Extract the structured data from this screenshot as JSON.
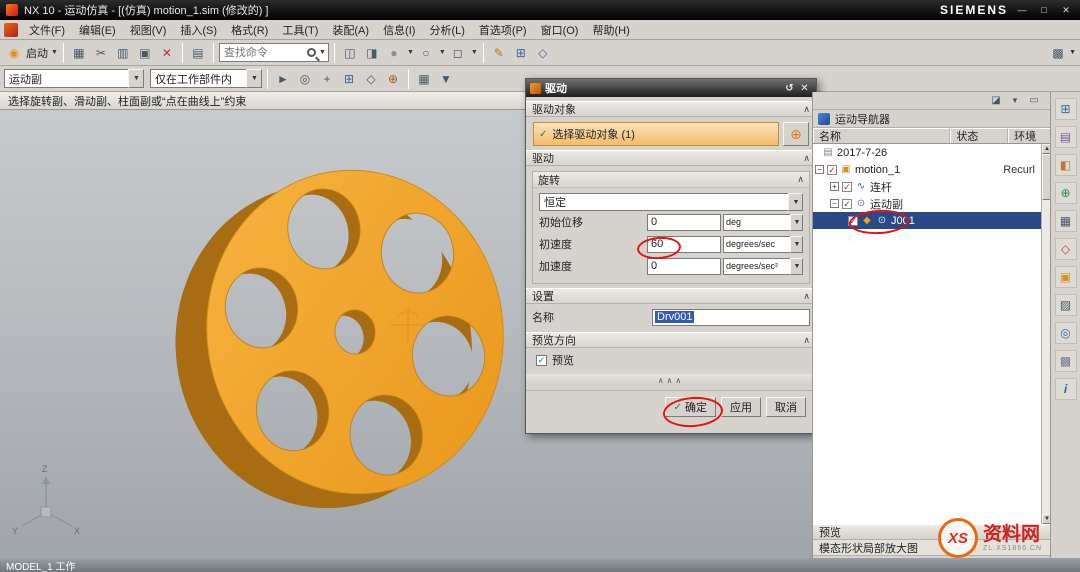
{
  "titlebar": {
    "title": "NX 10 - 运动仿真 - [(仿真) motion_1.sim (修改的) ]",
    "brand": "SIEMENS",
    "min": "—",
    "max": "□",
    "close": "✕"
  },
  "menubar": {
    "items": [
      "文件(F)",
      "编辑(E)",
      "视图(V)",
      "插入(S)",
      "格式(R)",
      "工具(T)",
      "装配(A)",
      "信息(I)",
      "分析(L)",
      "首选项(P)",
      "窗口(O)",
      "帮助(H)"
    ]
  },
  "toolbar1": {
    "start_label": "启动",
    "search_placeholder": "查找命令",
    "icons": [
      {
        "g": "◉"
      },
      {
        "g": "▦"
      },
      {
        "g": "✂"
      },
      {
        "g": "▥"
      },
      {
        "g": "▣"
      },
      {
        "g": "✕"
      },
      {
        "g": "▤"
      },
      {
        "g": "◫"
      },
      {
        "g": "◨"
      },
      {
        "g": "●"
      },
      {
        "g": "○"
      },
      {
        "g": "◻"
      },
      {
        "g": "✎"
      },
      {
        "g": "⊞"
      },
      {
        "g": "◇"
      },
      {
        "g": "▩"
      }
    ]
  },
  "toolbar2": {
    "joint_filter": "运动副",
    "scope": "仅在工作部件内",
    "icons": [
      {
        "g": "►"
      },
      {
        "g": "◎"
      },
      {
        "g": "+"
      },
      {
        "g": "⊞"
      },
      {
        "g": "◇"
      },
      {
        "g": "⊕"
      },
      {
        "g": "▦"
      },
      {
        "g": "▼"
      }
    ]
  },
  "prompt": {
    "text": "选择旋转副、滑动副、柱面副或“点在曲线上”约束"
  },
  "dialog": {
    "title": "驱动",
    "sec_drive_object": "驱动对象",
    "selection_text": "选择驱动对象 (1)",
    "sec_drive": "驱动",
    "sec_rotation": "旋转",
    "profile": "恒定",
    "rows": [
      {
        "label": "初始位移",
        "value": "0",
        "unit": "deg"
      },
      {
        "label": "初速度",
        "value": "60",
        "unit": "degrees/sec"
      },
      {
        "label": "加速度",
        "value": "0",
        "unit": "degrees/sec²"
      }
    ],
    "sec_settings": "设置",
    "name_label": "名称",
    "name_value": "Drv001",
    "sec_preview": "预览方向",
    "preview_label": "预览",
    "sash": "∧∧∧",
    "ok": "确定",
    "apply": "应用",
    "cancel": "取消"
  },
  "navigator": {
    "title": "运动导航器",
    "columns": [
      "名称",
      "状态",
      "环境"
    ],
    "rows": [
      {
        "label": "2017-7-26"
      },
      {
        "label": "motion_1",
        "env": "Recurl"
      },
      {
        "label": "连杆"
      },
      {
        "label": "运动副"
      },
      {
        "label": "J001"
      }
    ],
    "footer_header": "预览",
    "footer_caption": "模态形状局部放大图"
  },
  "paneltop": {
    "icons": [
      {
        "g": "◪"
      },
      {
        "g": "▼"
      },
      {
        "g": "▭"
      }
    ]
  },
  "rightstrip": {
    "icons": [
      {
        "g": "⊞"
      },
      {
        "g": "▤"
      },
      {
        "g": "◧"
      },
      {
        "g": "⊕"
      },
      {
        "g": "▦"
      },
      {
        "g": "◇"
      },
      {
        "g": "▣"
      },
      {
        "g": "▨"
      },
      {
        "g": "◎"
      },
      {
        "g": "▩"
      },
      {
        "g": "i"
      }
    ]
  },
  "statusbar": {
    "left": "MODEL_1 工作"
  },
  "watermark": {
    "logo": "XS",
    "site": "资料网",
    "domain": "ZL.XS1866.CN"
  },
  "icons": {
    "dropdown": "▼",
    "collapse": "∧",
    "check": "✓",
    "plus": "+",
    "minus": "−",
    "add_target": "⊕",
    "reset": "↺",
    "close": "✕"
  }
}
